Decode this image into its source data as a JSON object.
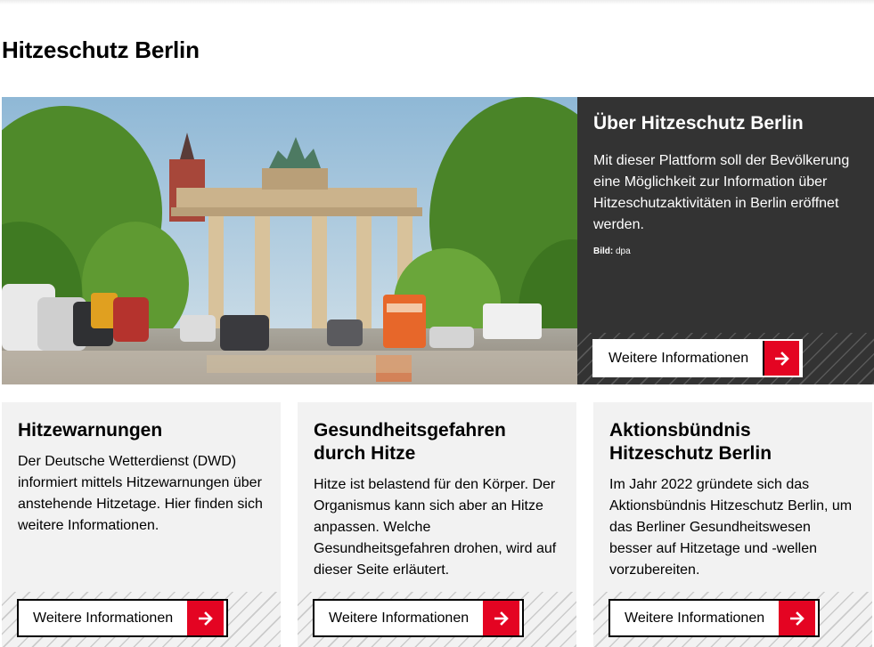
{
  "page": {
    "title": "Hitzeschutz Berlin"
  },
  "hero": {
    "title": "Über Hitzeschutz Berlin",
    "text": "Mit dieser Plattform soll der Bevölkerung eine Möglichkeit zur Information über Hitzeschutzaktivitäten in Berlin eröffnet werden.",
    "credit_label": "Bild:",
    "credit_value": "dpa",
    "button_label": "Weitere Informationen",
    "image_icon": "brandenburg-gate-photo"
  },
  "cards": [
    {
      "title": "Hitzewarnungen",
      "text": "Der Deutsche Wetterdienst (DWD) informiert mittels Hitzewarnungen über anstehende Hitzetage. Hier finden sich weitere Informationen.",
      "button_label": "Weitere Informationen"
    },
    {
      "title": "Gesundheitsgefahren durch Hitze",
      "text": "Hitze ist belastend für den Körper. Der Organismus kann sich aber an Hitze anpassen. Welche Gesundheitsgefahren drohen, wird auf dieser Seite erläutert.",
      "button_label": "Weitere Informationen"
    },
    {
      "title": "Aktionsbündnis Hitzeschutz Berlin",
      "text": "Im Jahr 2022 gründete sich das Aktionsbündnis Hitzeschutz Berlin, um das Berliner Gesundheitswesen besser auf Hitzetage und -wellen vorzubereiten.",
      "button_label": "Weitere Informationen"
    }
  ],
  "colors": {
    "accent": "#e40422",
    "panel": "#333333",
    "card": "#f2f2f2"
  },
  "icons": {
    "button_arrow": "arrow-right-icon"
  }
}
